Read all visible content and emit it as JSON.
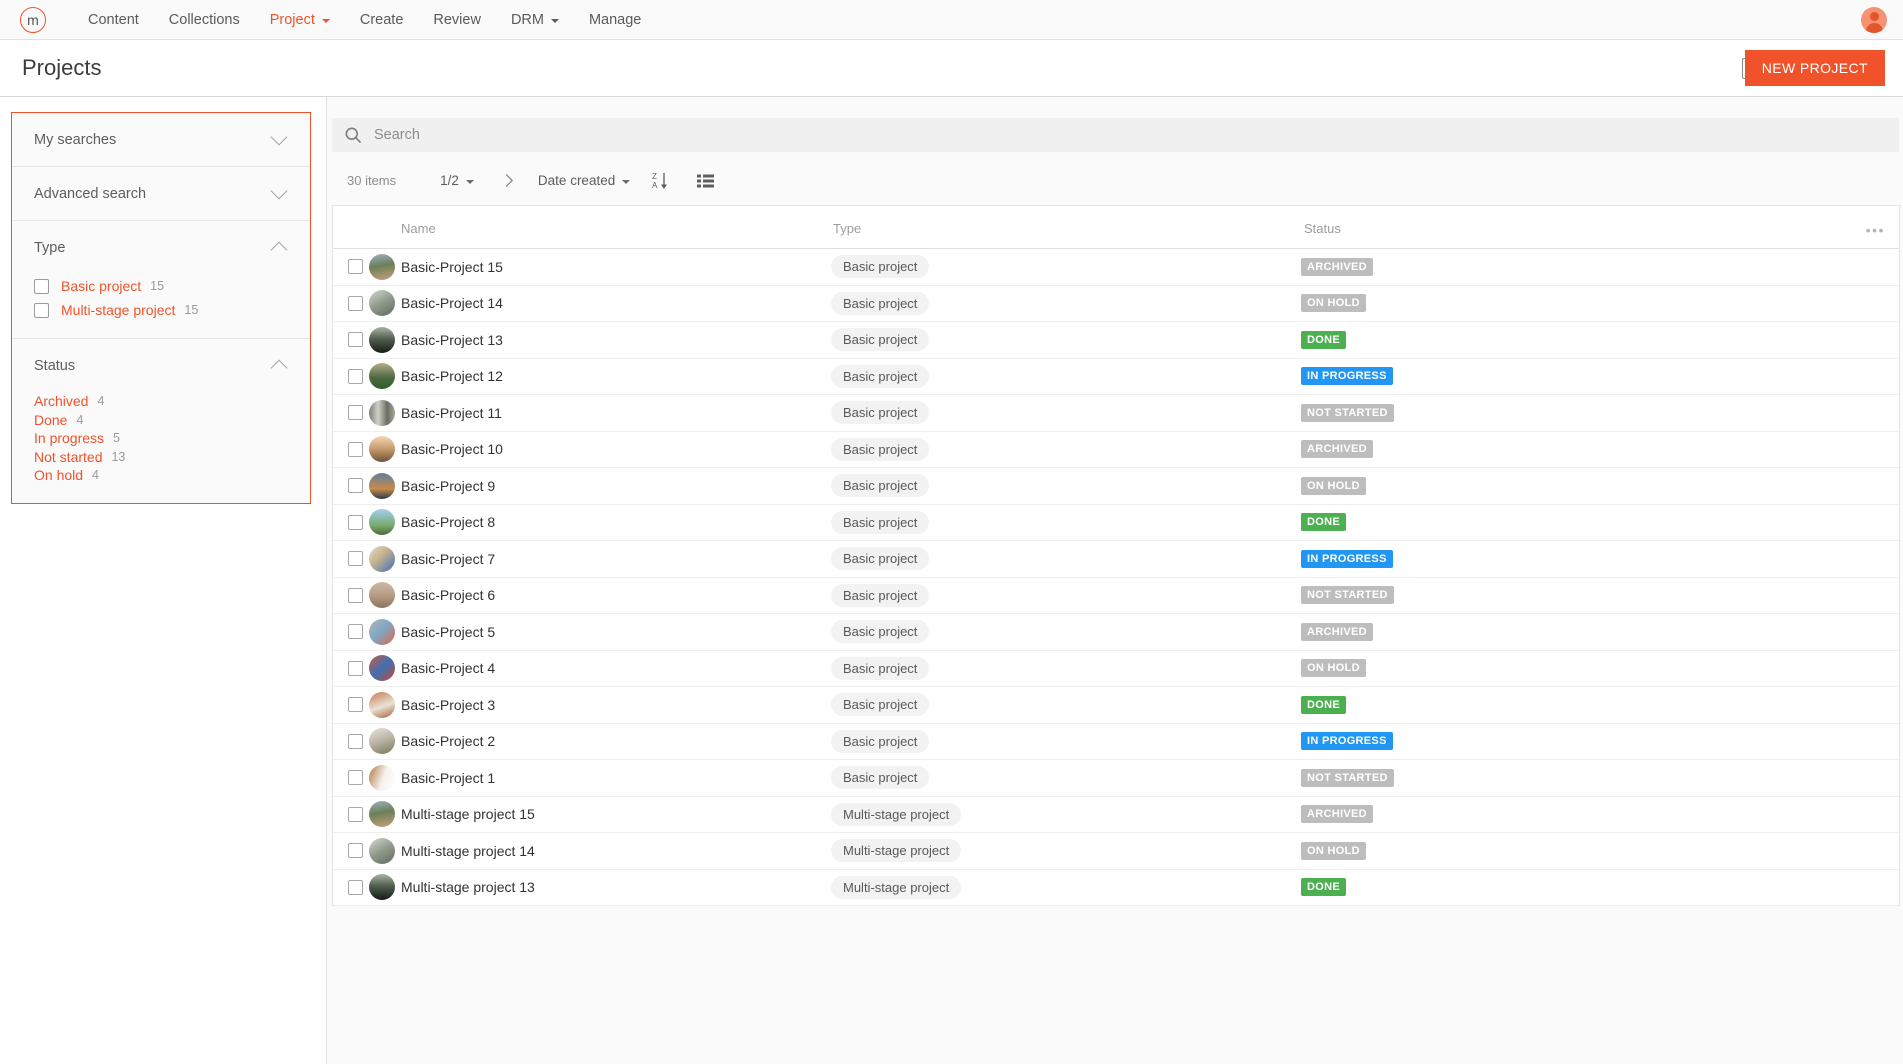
{
  "colors": {
    "brand": "#f0532a",
    "done": "#4caf50",
    "in_progress": "#2196f3",
    "neutral_badge": "#bdbdbd"
  },
  "topnav": {
    "logo_text": "m",
    "logo_icon": "circle-m-logo-icon",
    "items": [
      {
        "label": "Content",
        "active": false,
        "has_caret": false
      },
      {
        "label": "Collections",
        "active": false,
        "has_caret": false
      },
      {
        "label": "Project",
        "active": true,
        "has_caret": true
      },
      {
        "label": "Create",
        "active": false,
        "has_caret": false
      },
      {
        "label": "Review",
        "active": false,
        "has_caret": false
      },
      {
        "label": "DRM",
        "active": false,
        "has_caret": true
      },
      {
        "label": "Manage",
        "active": false,
        "has_caret": false
      }
    ],
    "avatar_icon": "user-avatar-icon"
  },
  "header": {
    "title": "Projects",
    "new_project_label": "NEW PROJECT"
  },
  "sidebar": {
    "my_searches": {
      "label": "My searches",
      "expanded": false
    },
    "advanced_search": {
      "label": "Advanced search",
      "expanded": false
    },
    "type": {
      "label": "Type",
      "expanded": true,
      "options": [
        {
          "label": "Basic project",
          "count": "15",
          "checked": false
        },
        {
          "label": "Multi-stage project",
          "count": "15",
          "checked": false
        }
      ]
    },
    "status": {
      "label": "Status",
      "expanded": true,
      "options": [
        {
          "label": "Archived",
          "count": "4"
        },
        {
          "label": "Done",
          "count": "4"
        },
        {
          "label": "In progress",
          "count": "5"
        },
        {
          "label": "Not started",
          "count": "13"
        },
        {
          "label": "On hold",
          "count": "4"
        }
      ]
    }
  },
  "search": {
    "placeholder": "Search",
    "value": "",
    "icon": "search-icon"
  },
  "toolbar": {
    "items_count": "30 items",
    "page_indicator": "1/2",
    "next_page_icon": "chevron-right-icon",
    "sort_field": "Date created",
    "sort_direction_icon": "sort-za-descending-icon",
    "view_mode_icon": "list-view-icon"
  },
  "table": {
    "columns": [
      "Name",
      "Type",
      "Status"
    ],
    "more_options": "•••",
    "rows": [
      {
        "name": "Basic-Project 15",
        "type": "Basic project",
        "status": "ARCHIVED",
        "status_class": "st-archived",
        "thumb": "linear-gradient(170deg,#9db3c6 0%,#6c7f58 45%,#c9a07a 100%)"
      },
      {
        "name": "Basic-Project 14",
        "type": "Basic project",
        "status": "ON HOLD",
        "status_class": "st-onhold",
        "thumb": "linear-gradient(150deg,#d5d9d4 0%,#8f9a8b 50%,#5f6a5c 100%)"
      },
      {
        "name": "Basic-Project 13",
        "type": "Basic project",
        "status": "DONE",
        "status_class": "st-done",
        "thumb": "linear-gradient(180deg,#a9b4a4 0%,#53604f 45%,#161a16 100%)"
      },
      {
        "name": "Basic-Project 12",
        "type": "Basic project",
        "status": "IN PROGRESS",
        "status_class": "st-inprogress",
        "thumb": "linear-gradient(180deg,#b6ae8c 0%,#4e6a42 55%,#2e5b2a 100%)"
      },
      {
        "name": "Basic-Project 11",
        "type": "Basic project",
        "status": "NOT STARTED",
        "status_class": "st-notstarted",
        "thumb": "linear-gradient(90deg,#7d7e72 0%,#cfd1c8 35%,#6b6d62 70%,#a8a79c 100%)"
      },
      {
        "name": "Basic-Project 10",
        "type": "Basic project",
        "status": "ARCHIVED",
        "status_class": "st-archived",
        "thumb": "linear-gradient(180deg,#f6d7b6 0%,#c59a6d 50%,#6e5238 100%)"
      },
      {
        "name": "Basic-Project 9",
        "type": "Basic project",
        "status": "ON HOLD",
        "status_class": "st-onhold",
        "thumb": "linear-gradient(180deg,#5f7f9e 0%,#c98a4b 60%,#2b3a4a 100%)"
      },
      {
        "name": "Basic-Project 8",
        "type": "Basic project",
        "status": "DONE",
        "status_class": "st-done",
        "thumb": "linear-gradient(180deg,#9fd0ef 0%,#7aa86a 65%,#4b6b3a 100%)"
      },
      {
        "name": "Basic-Project 7",
        "type": "Basic project",
        "status": "IN PROGRESS",
        "status_class": "st-inprogress",
        "thumb": "linear-gradient(135deg,#e3dfd2 0%,#c9b48e 40%,#3f6fb5 100%)"
      },
      {
        "name": "Basic-Project 6",
        "type": "Basic project",
        "status": "NOT STARTED",
        "status_class": "st-notstarted",
        "thumb": "linear-gradient(180deg,#cdb9a5 0%,#b79c84 50%,#8e7560 100%)"
      },
      {
        "name": "Basic-Project 5",
        "type": "Basic project",
        "status": "ARCHIVED",
        "status_class": "st-archived",
        "thumb": "linear-gradient(135deg,#b9b7b2 0%,#7fa9c7 45%,#d96a4a 100%)"
      },
      {
        "name": "Basic-Project 4",
        "type": "Basic project",
        "status": "ON HOLD",
        "status_class": "st-onhold",
        "thumb": "linear-gradient(135deg,#d05a3c 0%,#3f6fb5 50%,#c4482f 100%)"
      },
      {
        "name": "Basic-Project 3",
        "type": "Basic project",
        "status": "DONE",
        "status_class": "st-done",
        "thumb": "linear-gradient(160deg,#c8784a 0%,#e8e2d6 55%,#a85c32 100%)"
      },
      {
        "name": "Basic-Project 2",
        "type": "Basic project",
        "status": "IN PROGRESS",
        "status_class": "st-inprogress",
        "thumb": "linear-gradient(160deg,#e8e4dc 0%,#b9b2a4 50%,#6f7b55 100%)"
      },
      {
        "name": "Basic-Project 1",
        "type": "Basic project",
        "status": "NOT STARTED",
        "status_class": "st-notstarted",
        "thumb": "linear-gradient(110deg,#b07a45 0%,#f5f3ef 55%,#ffffff 100%)"
      },
      {
        "name": "Multi-stage project 15",
        "type": "Multi-stage project",
        "status": "ARCHIVED",
        "status_class": "st-archived",
        "thumb": "linear-gradient(170deg,#9db3c6 0%,#6c7f58 45%,#c9a07a 100%)"
      },
      {
        "name": "Multi-stage project 14",
        "type": "Multi-stage project",
        "status": "ON HOLD",
        "status_class": "st-onhold",
        "thumb": "linear-gradient(150deg,#d5d9d4 0%,#8f9a8b 50%,#5f6a5c 100%)"
      },
      {
        "name": "Multi-stage project 13",
        "type": "Multi-stage project",
        "status": "DONE",
        "status_class": "st-done",
        "thumb": "linear-gradient(180deg,#a9b4a4 0%,#53604f 45%,#161a16 100%)"
      }
    ]
  }
}
